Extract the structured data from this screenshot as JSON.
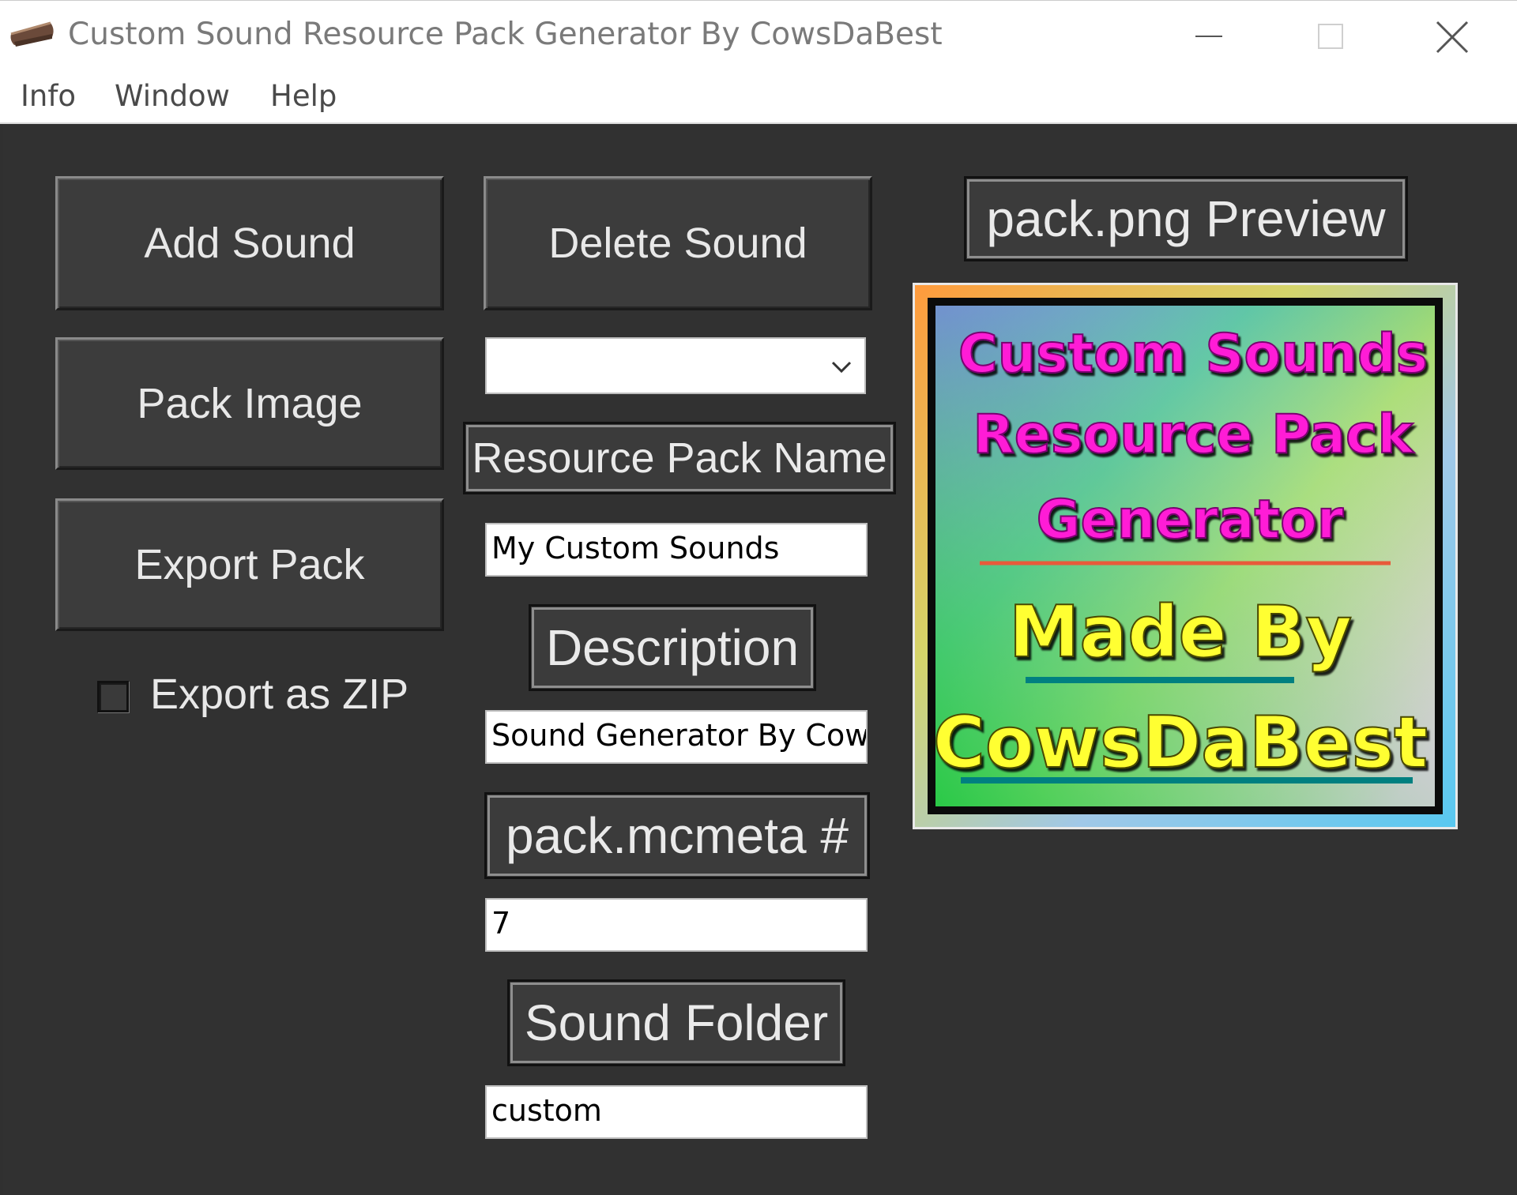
{
  "window": {
    "title": "Custom Sound Resource Pack Generator By CowsDaBest",
    "app_icon": "pie-slice-icon",
    "controls": [
      "minimize-icon",
      "maximize-icon",
      "close-icon"
    ]
  },
  "menu": {
    "items": [
      "Info",
      "Window",
      "Help"
    ]
  },
  "buttons": {
    "add_sound": "Add Sound",
    "delete_sound": "Delete Sound",
    "pack_image": "Pack Image",
    "export_pack": "Export Pack"
  },
  "export_zip": {
    "label": "Export as ZIP",
    "checked": false
  },
  "sound_select": {
    "value": ""
  },
  "fields": {
    "resource_pack_name_label": "Resource Pack Name",
    "resource_pack_name_value": "My Custom Sounds",
    "description_label": "Description",
    "description_value": "Sound Generator By CowsDaBest",
    "mcmeta_label": "pack.mcmeta #",
    "mcmeta_value": "7",
    "sound_folder_label": "Sound Folder",
    "sound_folder_value": "custom"
  },
  "preview": {
    "label": "pack.png Preview",
    "line1": "Custom Sounds",
    "line2": "Resource Pack",
    "line3": "Generator",
    "line4": "Made By",
    "line5": "CowsDaBest"
  },
  "colors": {
    "background": "#313131",
    "button": "#3c3c3c",
    "preview_magenta": "#ff1fd6",
    "preview_yellow": "#ffff33"
  }
}
